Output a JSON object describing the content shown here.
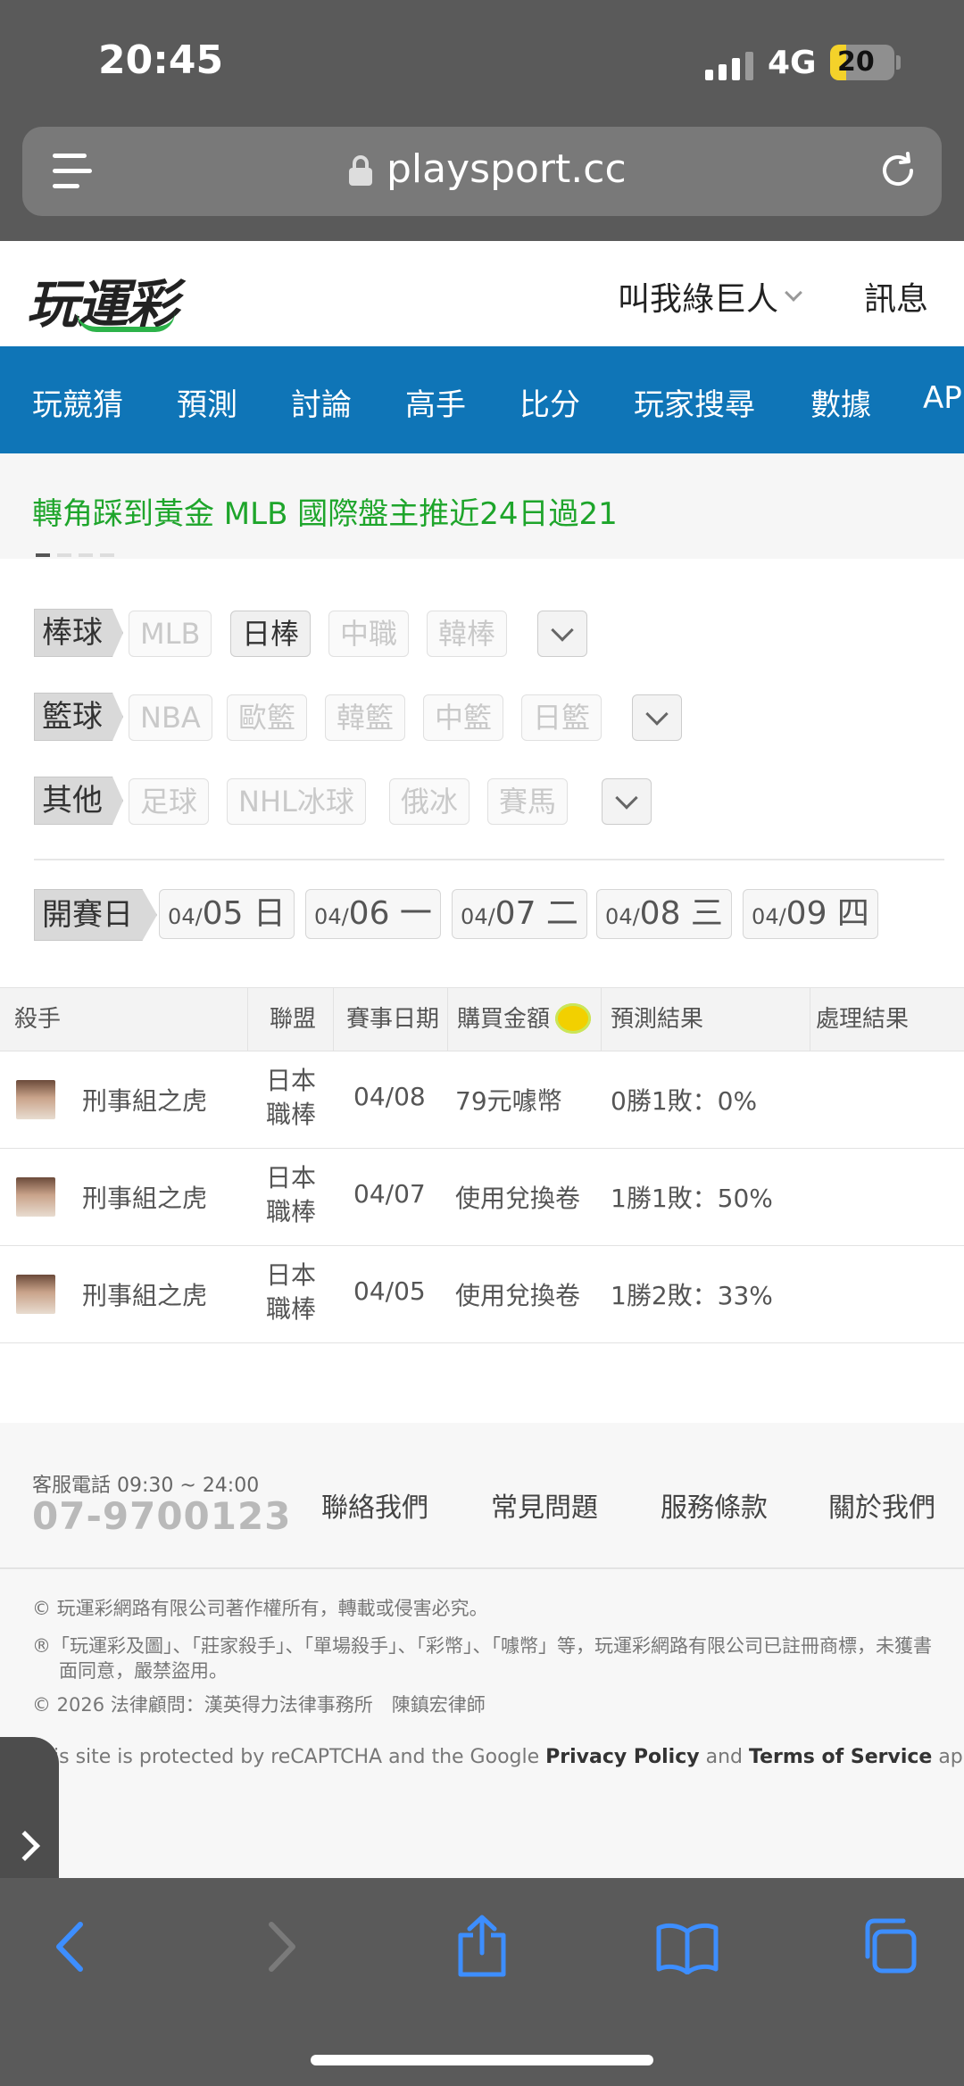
{
  "status": {
    "time": "20:45",
    "network": "4G",
    "battery": "20"
  },
  "browser": {
    "url": "playsport.cc"
  },
  "header": {
    "logo": "玩運彩",
    "user": "叫我綠巨人",
    "messages": "訊息"
  },
  "nav": [
    "玩競猜",
    "預測",
    "討論",
    "高手",
    "比分",
    "玩家搜尋",
    "數據",
    "AP"
  ],
  "ticker": {
    "text": "轉角踩到黃金 MLB 國際盤主推近24日過21"
  },
  "filters": {
    "baseball": {
      "label": "棒球",
      "chips": [
        "MLB",
        "日棒",
        "中職",
        "韓棒"
      ]
    },
    "basketball": {
      "label": "籃球",
      "chips": [
        "NBA",
        "歐籃",
        "韓籃",
        "中籃",
        "日籃"
      ]
    },
    "other": {
      "label": "其他",
      "chips": [
        "足球",
        "NHL冰球",
        "俄冰",
        "賽馬"
      ]
    }
  },
  "dates": {
    "label": "開賽日",
    "items": [
      {
        "mo": "04/",
        "day": "05 日"
      },
      {
        "mo": "04/",
        "day": "06 一"
      },
      {
        "mo": "04/",
        "day": "07 二"
      },
      {
        "mo": "04/",
        "day": "08 三"
      },
      {
        "mo": "04/",
        "day": "09 四"
      }
    ]
  },
  "table": {
    "headers": [
      "殺手",
      "聯盟",
      "賽事日期",
      "購買金額",
      "預測結果",
      "處理結果"
    ],
    "coin_icon": "coin-icon",
    "rows": [
      {
        "name": "刑事組之虎",
        "league": "日本職棒",
        "date": "04/08",
        "amount": "79元噱幣",
        "result": "0勝1敗：0%",
        "status": ""
      },
      {
        "name": "刑事組之虎",
        "league": "日本職棒",
        "date": "04/07",
        "amount": "使用兌換卷",
        "result": "1勝1敗：50%",
        "status": ""
      },
      {
        "name": "刑事組之虎",
        "league": "日本職棒",
        "date": "04/05",
        "amount": "使用兌換卷",
        "result": "1勝2敗：33%",
        "status": ""
      }
    ]
  },
  "footer": {
    "service_label": "客服電話 09:30 ~ 24:00",
    "phone": "07-9700123",
    "links": [
      "聯絡我們",
      "常見問題",
      "服務條款",
      "關於我們"
    ],
    "copyright": "© 玩運彩網路有限公司著作權所有，轉載或侵害必究。",
    "trademark": "®「玩運彩及圖」、「莊家殺手」、「單場殺手」、「彩幣」、「噱幣」等，玩運彩網路有限公司已註冊商標，未獲書面同意，嚴禁盜用。",
    "legal": "© 2026 法律顧問：漢英得力法律事務所　陳鎮宏律師",
    "recaptcha_pre": "is site is protected by reCAPTCHA and the Google ",
    "privacy": "Privacy Policy",
    "and": " and ",
    "terms": "Terms of Service",
    "apply": " apply."
  },
  "toolbar": [
    "back-icon",
    "forward-icon",
    "share-icon",
    "bookmarks-icon",
    "tabs-icon"
  ],
  "colors": {
    "nav": "#0f75b7",
    "ticker": "#1ea52b",
    "chrome": "#5a5a5a",
    "accent_icon": "#3d8eff"
  }
}
